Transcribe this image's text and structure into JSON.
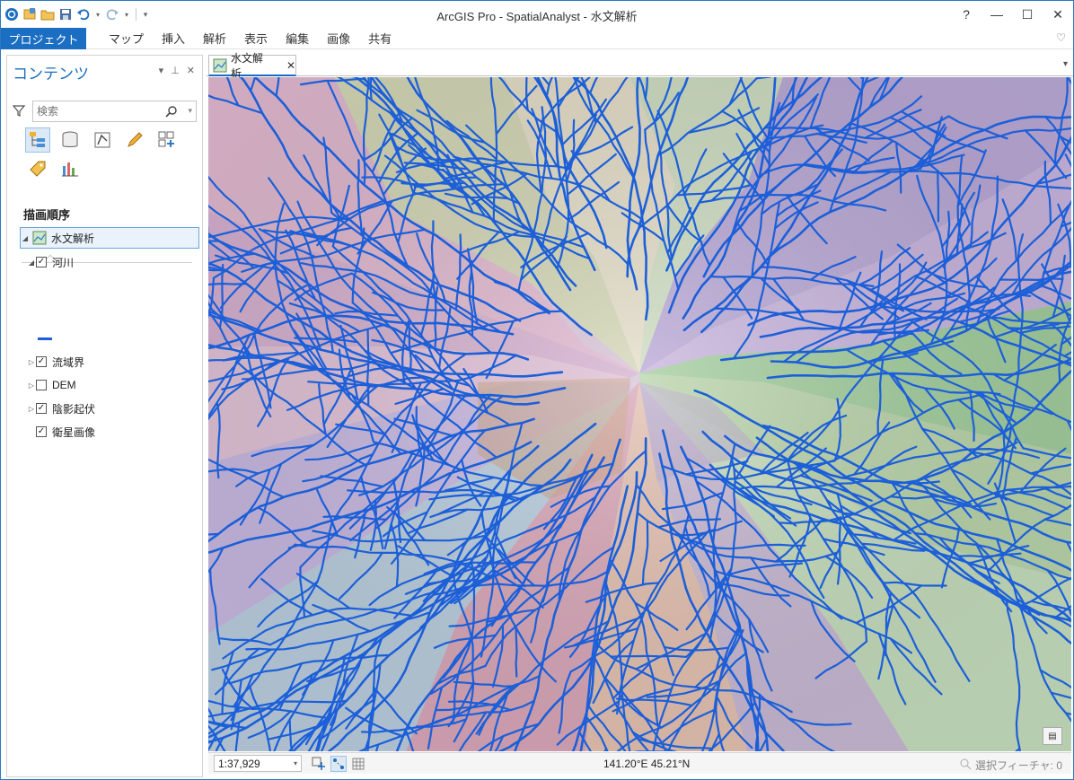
{
  "window": {
    "title": "ArcGIS Pro - SpatialAnalyst - 水文解析",
    "help": "?",
    "minimize": "—",
    "maximize": "☐",
    "close": "✕"
  },
  "ribbon": {
    "project_tab": "プロジェクト",
    "tabs": [
      "マップ",
      "挿入",
      "解析",
      "表示",
      "編集",
      "画像",
      "共有"
    ]
  },
  "contents": {
    "title": "コンテンツ",
    "search_placeholder": "検索",
    "section_label": "描画順序",
    "map_name": "水文解析",
    "layers": [
      {
        "name": "河川",
        "checked": true,
        "expanded": true
      },
      {
        "name": "流域界",
        "checked": true,
        "expanded": false
      },
      {
        "name": "DEM",
        "checked": false,
        "expanded": false
      },
      {
        "name": "陰影起伏",
        "checked": true,
        "expanded": false
      },
      {
        "name": "衛星画像",
        "checked": true,
        "expanded": false
      }
    ]
  },
  "map_view": {
    "tab_label": "水文解析",
    "stream_color": "#1c5fd8"
  },
  "statusbar": {
    "scale": "1:37,929",
    "coordinates": "141.20°E 45.21°N",
    "selected_features": "選択フィーチャ: 0"
  }
}
